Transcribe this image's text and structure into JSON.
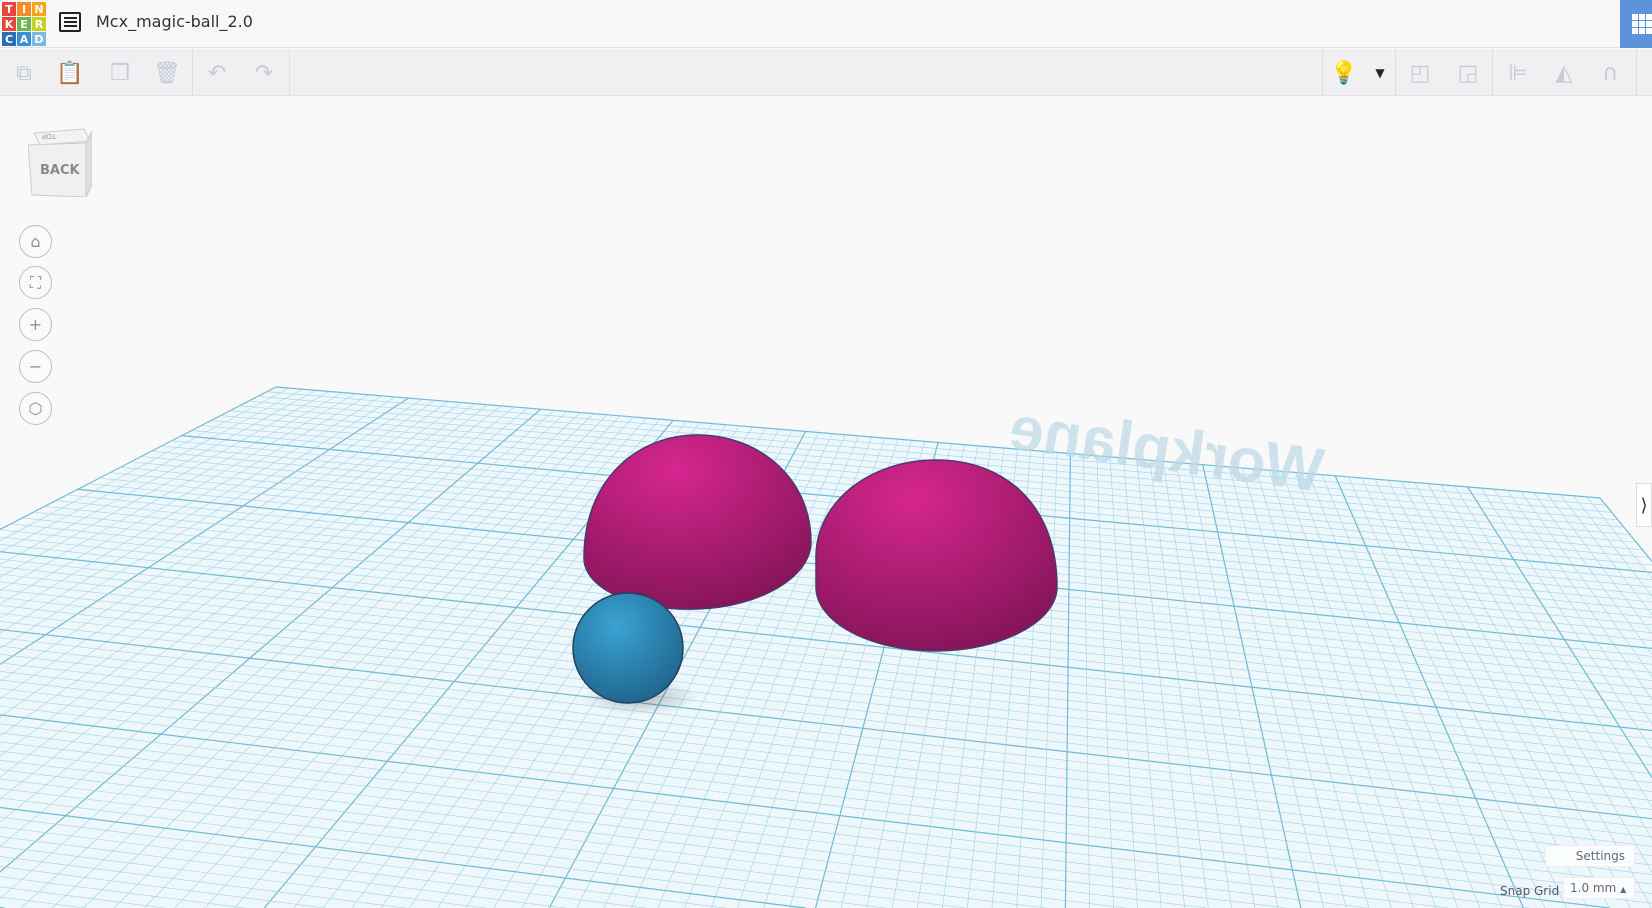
{
  "header": {
    "logo_letters": [
      "T",
      "I",
      "N",
      "K",
      "E",
      "R",
      "C",
      "A",
      "D"
    ],
    "logo_colors": [
      "#e8453c",
      "#f58c2c",
      "#f7a31c",
      "#e8453c",
      "#6ab74a",
      "#c6d12a",
      "#2b6cb4",
      "#3a8fd6",
      "#7fb9e3"
    ],
    "title": "Mcx_magic-ball_2.0"
  },
  "toolbar": {
    "copy": "copy-icon",
    "paste": "paste-icon",
    "duplicate": "duplicate-icon",
    "delete": "trash-icon",
    "undo": "undo-icon",
    "redo": "redo-icon",
    "light": "lightbulb-icon",
    "group": "group-icon",
    "ungroup": "ungroup-icon",
    "align": "align-icon",
    "mirror": "mirror-icon",
    "cruise": "cruise-icon"
  },
  "viewcube": {
    "front": "BACK",
    "top": "TOP"
  },
  "workplane": {
    "label": "Workplane"
  },
  "footer": {
    "settings": "Settings",
    "snap_label": "Snap Grid",
    "snap_value": "1.0 mm"
  },
  "colors": {
    "hemisphere": "#c41f82",
    "sphere": "#2c8ec0",
    "grid": "#9fd3e8"
  }
}
